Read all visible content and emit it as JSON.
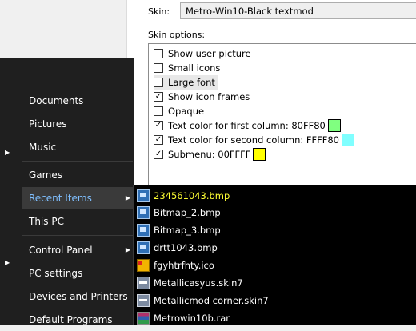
{
  "settings": {
    "skin_label": "Skin:",
    "skin_value": "Metro-Win10-Black textmod",
    "options_label": "Skin options:",
    "options": [
      {
        "label": "Show user picture",
        "checked": false
      },
      {
        "label": "Small icons",
        "checked": false
      },
      {
        "label": "Large font",
        "checked": false,
        "highlighted": true
      },
      {
        "label": "Show icon frames",
        "checked": true
      },
      {
        "label": "Opaque",
        "checked": false
      },
      {
        "label": "Text color for first column: 80FF80",
        "checked": true,
        "swatch": "#80ff80"
      },
      {
        "label": "Text color for second column: FFFF80",
        "checked": true,
        "swatch": "#80ffff"
      },
      {
        "label": "Submenu: 00FFFF",
        "checked": true,
        "swatch": "#ffff00"
      }
    ]
  },
  "start_menu": {
    "items": [
      {
        "label": "Documents",
        "arrow": false
      },
      {
        "label": "Pictures",
        "arrow": false
      },
      {
        "label": "Music",
        "arrow": false
      },
      {
        "label": "Games",
        "arrow": false
      },
      {
        "label": "Recent Items",
        "arrow": true,
        "selected": true
      },
      {
        "label": "This PC",
        "arrow": false
      },
      {
        "label": "Control Panel",
        "arrow": true
      },
      {
        "label": "PC settings",
        "arrow": false
      },
      {
        "label": "Devices and Printers",
        "arrow": false
      },
      {
        "label": "Default Programs",
        "arrow": false
      }
    ],
    "arrow_glyph": "▶"
  },
  "submenu": {
    "items": [
      {
        "label": "234561043.bmp",
        "icon": "bmp-icon"
      },
      {
        "label": "Bitmap_2.bmp",
        "icon": "bmp-icon"
      },
      {
        "label": "Bitmap_3.bmp",
        "icon": "bmp-icon"
      },
      {
        "label": "drtt1043.bmp",
        "icon": "bmp-icon"
      },
      {
        "label": "fgyhtrfhty.ico",
        "icon": "ico-icon"
      },
      {
        "label": "Metallicasyus.skin7",
        "icon": "skin-icon"
      },
      {
        "label": "Metallicmod corner.skin7",
        "icon": "skin-icon"
      },
      {
        "label": "Metrowin10b.rar",
        "icon": "rar-icon"
      }
    ]
  },
  "colors": {
    "menu_bg": "#1f1f1f",
    "submenu_bg": "#000000",
    "selected_text": "#7fbfff",
    "submenu_first_text": "#ffff33"
  }
}
